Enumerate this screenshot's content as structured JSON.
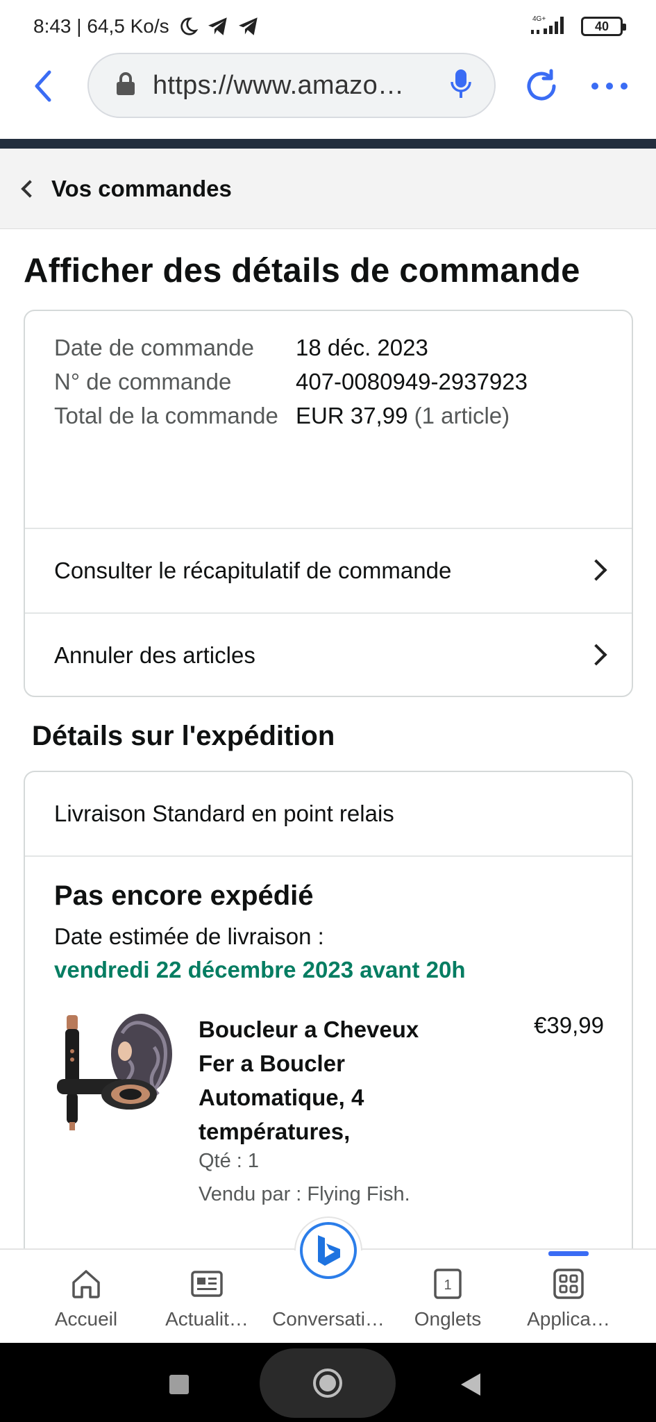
{
  "status_bar": {
    "time_speed": "8:43 | 64,5 Ko/s",
    "network": "4G+",
    "battery": "40"
  },
  "browser": {
    "url": "https://www.amazo…"
  },
  "breadcrumb": {
    "label": "Vos commandes"
  },
  "page_title": "Afficher des détails de commande",
  "order_info": {
    "date_label": "Date de commande",
    "date_value": "18 déc. 2023",
    "number_label": "N° de commande",
    "number_value": "407-0080949-2937923",
    "total_label": "Total de la commande",
    "total_value": "EUR 37,99",
    "total_items": "(1 article)"
  },
  "order_links": {
    "summary": "Consulter le récapitulatif de commande",
    "cancel": "Annuler des articles"
  },
  "shipping": {
    "section_title": "Détails sur l'expédition",
    "method": "Livraison Standard en point relais",
    "status": "Pas encore expédié",
    "estimate_label": "Date estimée de livraison :",
    "estimate_date": "vendredi 22 décembre 2023 avant 20h",
    "date_color": "#067d62"
  },
  "product": {
    "title": "Boucleur a Cheveux Fer a Boucler Automatique, 4 températures,",
    "price": "€39,99",
    "qty": "Qté : 1",
    "seller": "Vendu par : Flying Fish."
  },
  "bottom_nav": {
    "items": [
      {
        "label": "Accueil",
        "icon": "home-icon"
      },
      {
        "label": "Actualit…",
        "icon": "news-icon"
      },
      {
        "label": "Conversati…",
        "icon": "bing-chat-icon"
      },
      {
        "label": "Onglets",
        "icon": "tabs-icon",
        "count": "1"
      },
      {
        "label": "Applica…",
        "icon": "apps-icon"
      }
    ]
  },
  "colors": {
    "accent": "#3a6cf4",
    "header_dark": "#232f3e"
  }
}
